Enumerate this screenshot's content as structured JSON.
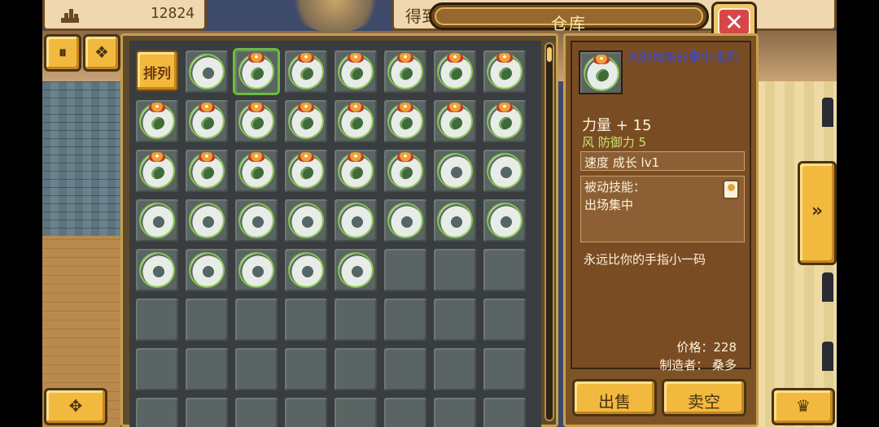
{
  "hud": {
    "coins_value": "12824",
    "gain_label": "得到"
  },
  "window": {
    "title": "仓库",
    "close_label": "✕"
  },
  "buttons": {
    "pause_label": "⏸",
    "gem_label": "❖",
    "dpad_label": "✥",
    "crown_label": "♛",
    "next_label": "»",
    "sort_label": "排列",
    "sell_label": "出售",
    "sell_all_label": "卖空"
  },
  "inventory": {
    "columns": 8,
    "rows": 8,
    "selected_index": 2,
    "slots": [
      "sort",
      "ring",
      "gem",
      "gem",
      "gem",
      "gem",
      "gem",
      "gem",
      "gem",
      "gem",
      "gem",
      "gem",
      "gem",
      "gem",
      "gem",
      "gem",
      "gem",
      "gem",
      "gem",
      "gem",
      "gem",
      "gem",
      "ring",
      "ring",
      "ring",
      "ring",
      "ring",
      "ring",
      "ring",
      "ring",
      "ring",
      "ring",
      "ring",
      "ring",
      "ring",
      "ring",
      "ring",
      "empty",
      "empty",
      "empty",
      "empty",
      "empty",
      "empty",
      "empty",
      "empty",
      "empty",
      "empty",
      "empty",
      "empty",
      "empty",
      "empty",
      "empty",
      "empty",
      "empty",
      "empty",
      "empty",
      "empty",
      "empty",
      "empty",
      "empty",
      "empty",
      "empty",
      "empty",
      "empty"
    ]
  },
  "detail": {
    "item_name": "风的残酷的集中戒指",
    "stat_main": "力量 + 15",
    "stat_sub": "风 防御力 5",
    "speed": "速度 成长 lv1",
    "skill_title": "被动技能：",
    "skill_name": "出场集中",
    "flavor": "永远比你的手指小一码",
    "price": "价格：228",
    "maker": "制造者： 桑多"
  },
  "colors": {
    "panel_gold": "#c99f4d",
    "button_gold": "#f2b93f",
    "item_name_blue": "#2f48e0",
    "stat_green": "#c9e36f",
    "close_red": "#d7474a",
    "selected_green": "#6dbd3a"
  }
}
